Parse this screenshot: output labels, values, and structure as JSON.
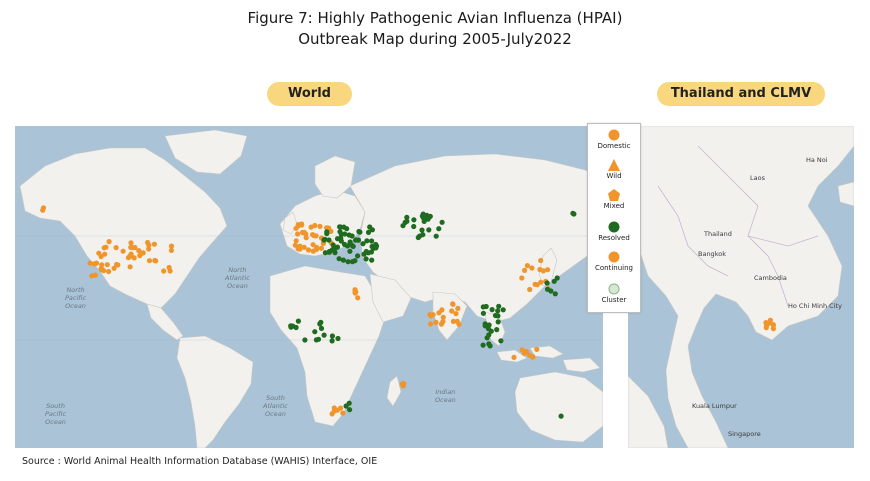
{
  "figure": {
    "title_line1": "Figure 7: Highly Pathogenic Avian Influenza (HPAI)",
    "title_line2": "Outbreak Map during 2005-July2022"
  },
  "panels": {
    "world_label": "World",
    "thai_label": "Thailand and CLMV"
  },
  "legend": {
    "items": [
      {
        "label": "Domestic",
        "shape": "circle",
        "color": "#f0952b"
      },
      {
        "label": "Wild",
        "shape": "triangle",
        "color": "#f0952b"
      },
      {
        "label": "Mixed",
        "shape": "pentagon",
        "color": "#f0952b"
      },
      {
        "label": "Resolved",
        "shape": "circle",
        "color": "#1f6b1f"
      },
      {
        "label": "Continuing",
        "shape": "circle",
        "color": "#f0952b"
      },
      {
        "label": "Cluster",
        "shape": "circle",
        "color": "#d4e8d2"
      }
    ]
  },
  "world_map_labels": {
    "north_pacific": "North\nPacific\nOcean",
    "north_atlantic": "North\nAtlantic\nOcean",
    "south_pacific": "South\nPacific\nOcean",
    "south_atlantic": "South\nAtlantic\nOcean",
    "indian_ocean": "Indian\nOcean"
  },
  "thai_map_labels": {
    "laos": "Laos",
    "thailand": "Thailand",
    "bangkok": "Bangkok",
    "cambodia": "Cambodia",
    "hanoi": "Ha Noi",
    "hcmc": "Ho Chi Minh City",
    "kuala_lumpur": "Kuala Lumpur",
    "singapore": "Singapore"
  },
  "colors": {
    "ocean": "#aac3d6",
    "land": "#f2f1ee",
    "domestic_orange": "#f0952b",
    "resolved_green": "#1f6b1f",
    "pill_yellow": "#f9d77e"
  },
  "source": "Source : World Animal Health Information Database (WAHIS) Interface, OIE"
}
